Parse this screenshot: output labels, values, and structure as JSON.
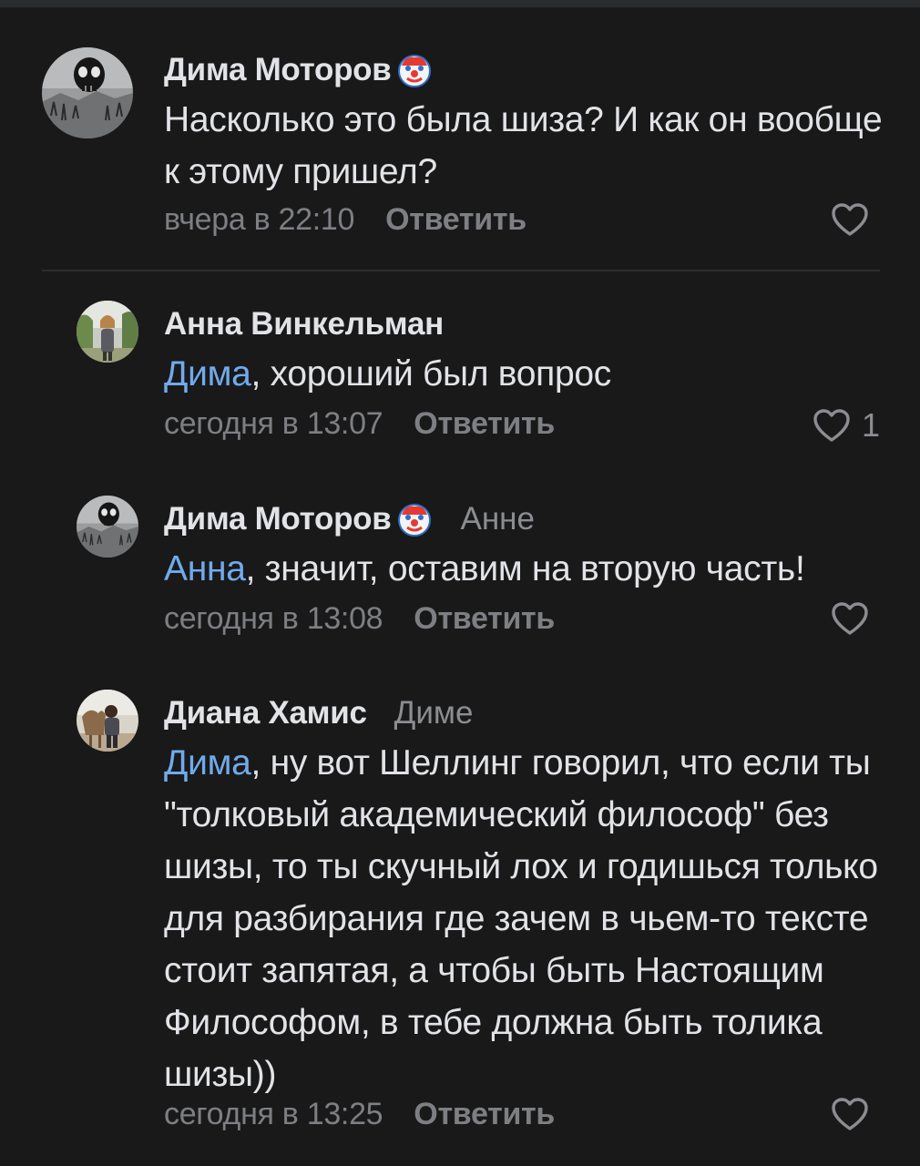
{
  "comments": [
    {
      "author": "Дима Моторов",
      "reply_to": "",
      "mention": "",
      "text": "Насколько это была шиза? И как он вообще к этому пришел?",
      "time": "вчера в 22:10",
      "reply_label": "Ответить",
      "likes": "",
      "badge_icon": "clown-face-emoji",
      "avatar_icon": "skull-avatar"
    },
    {
      "author": "Анна Винкельман",
      "reply_to": "",
      "mention": "Дима",
      "text": ", хороший был вопрос",
      "time": "сегодня в 13:07",
      "reply_label": "Ответить",
      "likes": "1",
      "avatar_icon": "person-photo-avatar"
    },
    {
      "author": "Дима Моторов",
      "reply_to": "Анне",
      "mention": "Анна",
      "text": ", значит, оставим на вторую часть!",
      "time": "сегодня в 13:08",
      "reply_label": "Ответить",
      "likes": "",
      "badge_icon": "clown-face-emoji",
      "avatar_icon": "skull-avatar"
    },
    {
      "author": "Диана Хамис",
      "reply_to": "Диме",
      "mention": "Дима",
      "text": ", ну вот Шеллинг говорил, что если ты \"толковый академический философ\" без шизы, то ты скучный лох и годишься только для разбирания где зачем в чьем-то тексте стоит запятая, а чтобы быть Настоящим Философом, в тебе должна быть толика шизы))",
      "time": "сегодня в 13:25",
      "reply_label": "Ответить",
      "likes": "",
      "avatar_icon": "person-with-camel-avatar"
    }
  ],
  "colors": {
    "background": "#19191a",
    "text": "#e1e3e6",
    "mention": "#71aaeb",
    "secondary": "#7d7f83"
  }
}
